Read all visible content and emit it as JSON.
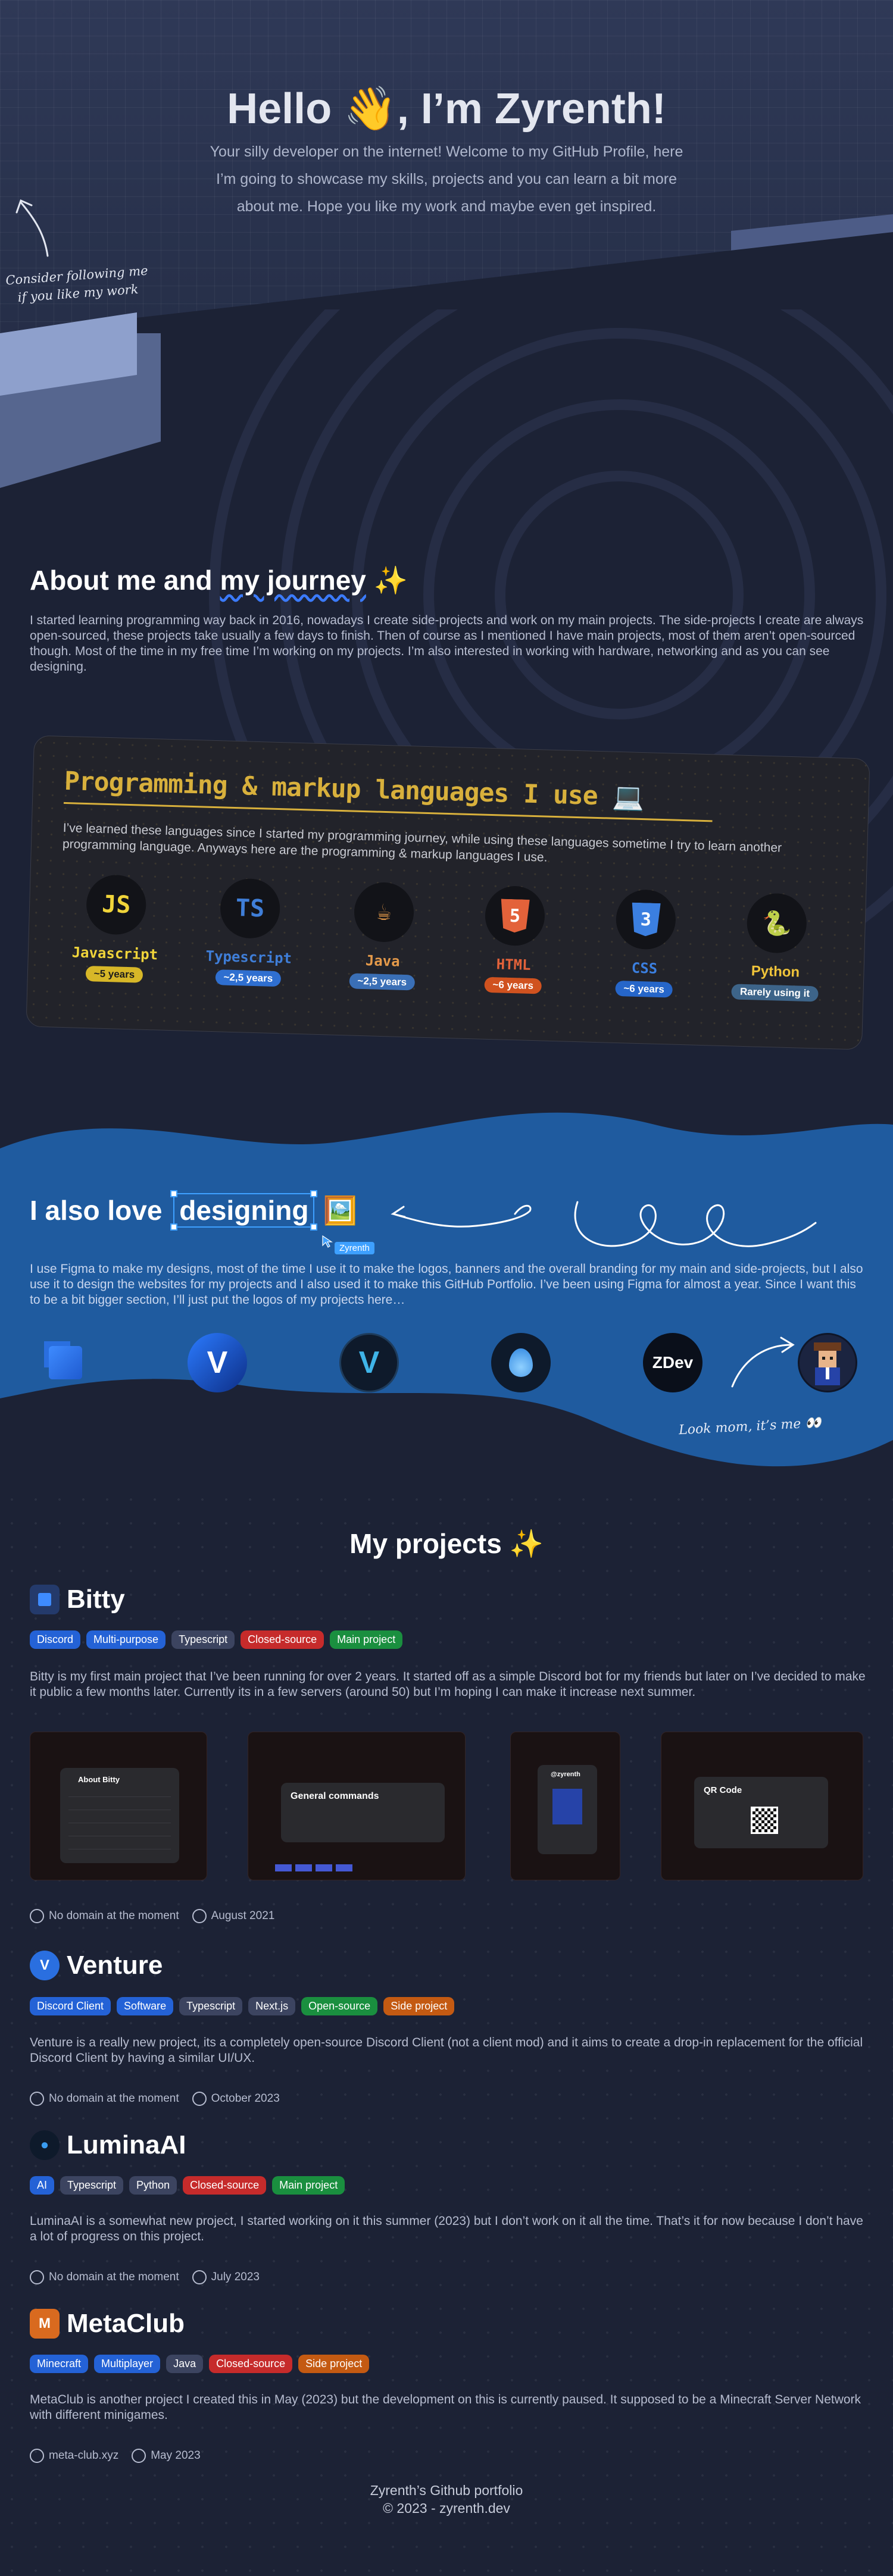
{
  "hero": {
    "title": "Hello 👋, I’m Zyrenth!",
    "subtitle_lines": [
      "Your silly developer on the internet! Welcome to my GitHub Profile, here",
      "I’m going to showcase my skills, projects and you can learn a bit more",
      "about me. Hope you like my work and maybe even get inspired."
    ],
    "follow_hint_lines": [
      "Consider following me",
      "if you like my work"
    ]
  },
  "about": {
    "title_prefix": "About me and ",
    "title_highlight": "my journey",
    "title_emoji": "✨",
    "text": "I started learning programming way back in 2016, nowadays I create side-projects and work on my main projects. The side-projects I create are always open-sourced, these projects take usually a few days to finish. Then of course as I mentioned I have main projects, most of them aren’t open-sourced though. Most of the time in my free time I’m working on my projects. I’m also interested in working with hardware, networking and as you can see designing."
  },
  "languages": {
    "title": "Programming & markup languages I use 💻",
    "text": "I’ve learned these languages since I started my programming journey, while using these languages sometime I try to learn another programming language. Anyways here are the programming & markup languages I use.",
    "items": [
      {
        "name": "Javascript",
        "icon_text": "JS",
        "icon": "javascript-icon",
        "years": "~5 years",
        "color": "#f0d43a",
        "pill_bg": "#d7b728",
        "pill_fg": "#1c1c1c"
      },
      {
        "name": "Typescript",
        "icon_text": "TS",
        "icon": "typescript-icon",
        "years": "~2,5 years",
        "color": "#3f7ed8",
        "pill_bg": "#2f6fd0",
        "pill_fg": "#ffffff"
      },
      {
        "name": "Java",
        "icon_text": "☕",
        "icon": "java-icon",
        "years": "~2,5 years",
        "color": "#e59a4a",
        "pill_bg": "#3a6fb6",
        "pill_fg": "#ffffff"
      },
      {
        "name": "HTML",
        "icon_text": "5",
        "icon": "html-icon",
        "years": "~6 years",
        "color": "#e3623a",
        "pill_bg": "#d0521f",
        "pill_fg": "#ffffff"
      },
      {
        "name": "CSS",
        "icon_text": "3",
        "icon": "css-icon",
        "years": "~6 years",
        "color": "#3b7fe0",
        "pill_bg": "#2666c9",
        "pill_fg": "#ffffff"
      },
      {
        "name": "Python",
        "icon_text": "🐍",
        "icon": "python-icon",
        "years": "Rarely using it",
        "color": "#f0c43a",
        "pill_bg": "#3d6489",
        "pill_fg": "#ffffff"
      }
    ]
  },
  "design": {
    "title_prefix": "I also love ",
    "title_highlight": "designing",
    "title_emoji": "🖼️",
    "cursor_label": "Zyrenth",
    "text": "I use Figma to make my designs, most of the time I use it to make the logos, banners and the overall branding for my main and side-projects, but I also use it to design the websites for my projects and I also used it to make this GitHub Portfolio. I’ve been using Figma for almost a year. Since I want this to be a bit bigger section, I’ll just put the logos of my projects here…",
    "logos": [
      {
        "name": "bitty-logo",
        "text": "▣"
      },
      {
        "name": "venture-logo",
        "text": "V"
      },
      {
        "name": "venture-dark-logo",
        "text": "V"
      },
      {
        "name": "lumina-logo",
        "text": "●"
      },
      {
        "name": "zdev-logo",
        "text": "ZDev"
      },
      {
        "name": "avatar-logo",
        "text": "☺"
      }
    ],
    "look_mom": "Look mom, it’s me 👀"
  },
  "projects": {
    "title": "My projects ✨",
    "items": [
      {
        "name": "Bitty",
        "icon_color": "#2a6fe0",
        "icon_text": "▣",
        "tags": [
          {
            "label": "Discord",
            "color": "blue"
          },
          {
            "label": "Multi-purpose",
            "color": "blue"
          },
          {
            "label": "Typescript",
            "color": "gray"
          },
          {
            "label": "Closed-source",
            "color": "red"
          },
          {
            "label": "Main project",
            "color": "green"
          }
        ],
        "text": "Bitty is my first main project that I’ve been running for over 2 years. It started off as a simple Discord bot for my friends but later on I’ve decided to make it public a few months later. Currently its in a few servers (around 50) but I’m hoping I can make it increase next summer.",
        "domain": "No domain at the moment",
        "date": "August 2021",
        "screens": [
          "About Bitty",
          "General commands",
          "@zyrenth",
          "QR Code"
        ]
      },
      {
        "name": "Venture",
        "icon_color": "#2a6fe0",
        "icon_text": "V",
        "tags": [
          {
            "label": "Discord Client",
            "color": "blue"
          },
          {
            "label": "Software",
            "color": "blue"
          },
          {
            "label": "Typescript",
            "color": "gray"
          },
          {
            "label": "Next.js",
            "color": "gray"
          },
          {
            "label": "Open-source",
            "color": "green"
          },
          {
            "label": "Side project",
            "color": "orange"
          }
        ],
        "text": "Venture is a really new project, its a completely open-source Discord Client (not a client mod) and it aims to create a drop-in replacement for the official Discord Client by having a similar UI/UX.",
        "domain": "No domain at the moment",
        "date": "October 2023"
      },
      {
        "name": "LuminaAI",
        "icon_color": "#3a78c8",
        "icon_text": "●",
        "tags": [
          {
            "label": "AI",
            "color": "blue"
          },
          {
            "label": "Typescript",
            "color": "gray"
          },
          {
            "label": "Python",
            "color": "gray"
          },
          {
            "label": "Closed-source",
            "color": "red"
          },
          {
            "label": "Main project",
            "color": "green"
          }
        ],
        "text": "LuminaAI is a somewhat new project, I started working on it this summer (2023) but I don’t work on it all the time. That’s it for now because I don’t have a lot of progress on this project.",
        "domain": "No domain at the moment",
        "date": "July 2023"
      },
      {
        "name": "MetaClub",
        "icon_color": "#d96a1f",
        "icon_text": "M",
        "tags": [
          {
            "label": "Minecraft",
            "color": "blue"
          },
          {
            "label": "Multiplayer",
            "color": "blue"
          },
          {
            "label": "Java",
            "color": "gray"
          },
          {
            "label": "Closed-source",
            "color": "red"
          },
          {
            "label": "Side project",
            "color": "orange"
          }
        ],
        "text": "MetaClub is another project I created this in May (2023) but the development on this is currently paused. It supposed to be a Minecraft Server Network with different minigames.",
        "domain": "meta-club.xyz",
        "date": "May 2023"
      }
    ]
  },
  "footer": {
    "line1": "Zyrenth’s Github portfolio",
    "line2": "© 2023 - zyrenth.dev"
  }
}
